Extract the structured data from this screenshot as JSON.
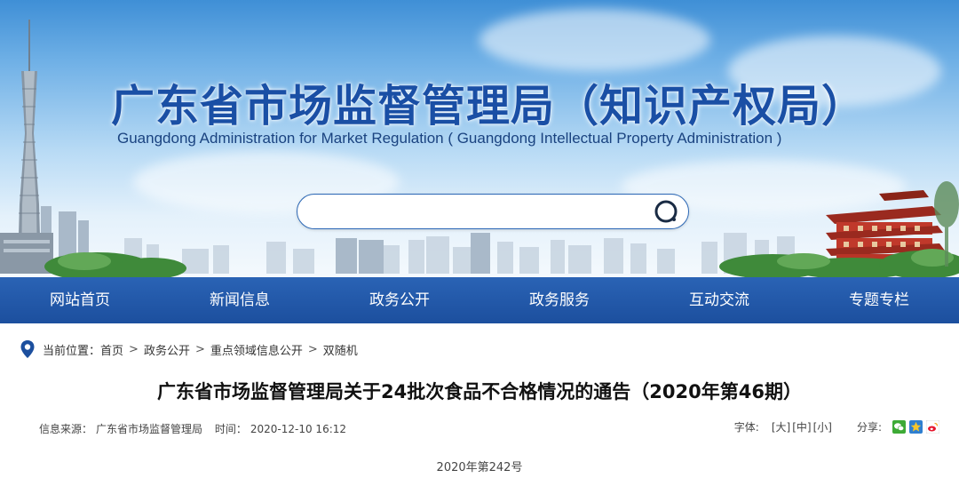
{
  "header": {
    "title_cn": "广东省市场监督管理局（知识产权局）",
    "title_en": "Guangdong Administration for Market Regulation ( Guangdong Intellectual Property Administration )",
    "search": {
      "value": "",
      "placeholder": ""
    }
  },
  "nav": {
    "items": [
      "网站首页",
      "新闻信息",
      "政务公开",
      "政务服务",
      "互动交流",
      "专题专栏"
    ]
  },
  "breadcrumb": {
    "label": "当前位置：",
    "items": [
      "首页",
      "政务公开",
      "重点领域信息公开",
      "双随机"
    ],
    "separator": ">"
  },
  "article": {
    "title": "广东省市场监督管理局关于24批次食品不合格情况的通告（2020年第46期）",
    "source_label": "信息来源：",
    "source": "广东省市场监督管理局",
    "time_label": "时间：",
    "time": "2020-12-10 16:12",
    "font_label": "字体:",
    "font_sizes": [
      "[大]",
      "[中]",
      "[小]"
    ],
    "share_label": "分享:",
    "share_icons": [
      "wechat-icon",
      "qzone-icon",
      "weibo-icon"
    ],
    "doc_number": "2020年第242号"
  },
  "colors": {
    "title_blue": "#1a4fa5",
    "nav_blue": "#1c4f9e",
    "loc_icon": "#1c4f9e"
  }
}
